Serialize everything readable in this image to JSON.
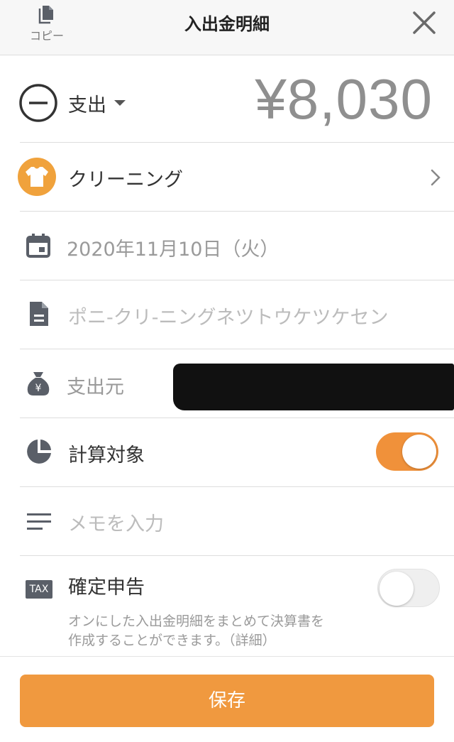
{
  "header": {
    "title": "入出金明細",
    "copy_label": "コピー"
  },
  "type_row": {
    "type_label": "支出",
    "amount": "¥8,030"
  },
  "category_row": {
    "label": "クリーニング"
  },
  "date_row": {
    "value": "2020年11月10日（火）"
  },
  "content_row": {
    "value": "ポニ-クリ-ニングネツトウケツケセン"
  },
  "source_row": {
    "label": "支出元"
  },
  "calc_row": {
    "label": "計算対象",
    "enabled": true
  },
  "memo_row": {
    "placeholder": "メモを入力"
  },
  "tax_row": {
    "badge": "TAX",
    "label": "確定申告",
    "enabled": false,
    "description_line1": "オンにした入出金明細をまとめて決算書を",
    "description_line2": "作成することができます。（詳細）"
  },
  "footer": {
    "save_label": "保存"
  },
  "colors": {
    "accent": "#f0913a",
    "save_button": "#f0993f",
    "icon_gray": "#5a5f68",
    "amount_gray": "#8f8f8f"
  }
}
